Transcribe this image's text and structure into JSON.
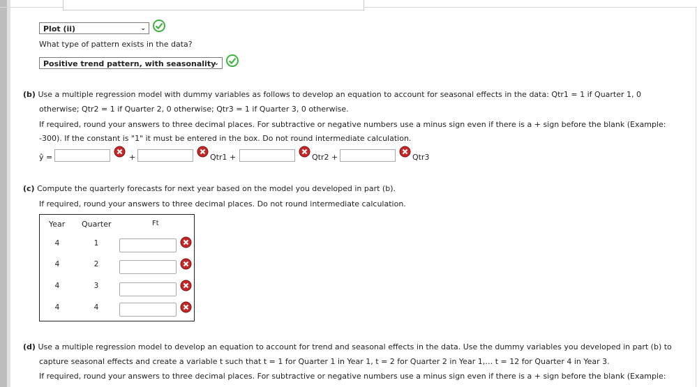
{
  "part_a": {
    "plot_select": "Plot (ii)",
    "pattern_question": "What type of pattern exists in the data?",
    "pattern_select": "Positive trend pattern, with seasonality"
  },
  "part_b": {
    "label": "(b)",
    "text_line1": "Use a multiple regression model with dummy variables as follows to develop an equation to account for seasonal effects in the data: Qtr1 = 1 if Quarter 1, 0",
    "text_line2": "otherwise; Qtr2 = 1 if Quarter 2, 0 otherwise; Qtr3 = 1 if Quarter 3, 0 otherwise.",
    "instr_line1": "If required, round your answers to three decimal places. For subtractive or negative numbers use a minus sign even if there is a + sign before the blank (Example:",
    "instr_line2": "-300). If the constant is \"1\" it must be entered in the box. Do not round intermediate calculation.",
    "yhat": "ŷ =",
    "plus1": "+",
    "qtr1": "Qtr1 +",
    "qtr2": "Qtr2 +",
    "qtr3": "Qtr3"
  },
  "part_c": {
    "label": "(c)",
    "text": "Compute the quarterly forecasts for next year based on the model you developed in part (b).",
    "instr": "If required, round your answers to three decimal places. Do not round intermediate calculation.",
    "headers": {
      "year": "Year",
      "quarter": "Quarter",
      "ft": "Ft"
    },
    "rows": [
      {
        "year": "4",
        "quarter": "1"
      },
      {
        "year": "4",
        "quarter": "2"
      },
      {
        "year": "4",
        "quarter": "3"
      },
      {
        "year": "4",
        "quarter": "4"
      }
    ]
  },
  "part_d": {
    "label": "(d)",
    "text_line1": "Use a multiple regression model to develop an equation to account for trend and seasonal effects in the data. Use the dummy variables you developed in part (b) to",
    "text_line2": "capture seasonal effects and create a variable t such that t = 1 for Quarter 1 in Year 1, t = 2 for Quarter 2 in Year 1,… t = 12 for Quarter 4 in Year 3.",
    "instr_line1": "If required, round your answers to three decimal places. For subtractive or negative numbers use a minus sign even if there is a + sign before the blank (Example:"
  },
  "colors": {
    "correct": "#3db33d",
    "incorrect": "#c62828",
    "border": "#a9a9a9"
  },
  "icons": {
    "correct": "check-circle-icon",
    "incorrect": "x-circle-icon"
  }
}
